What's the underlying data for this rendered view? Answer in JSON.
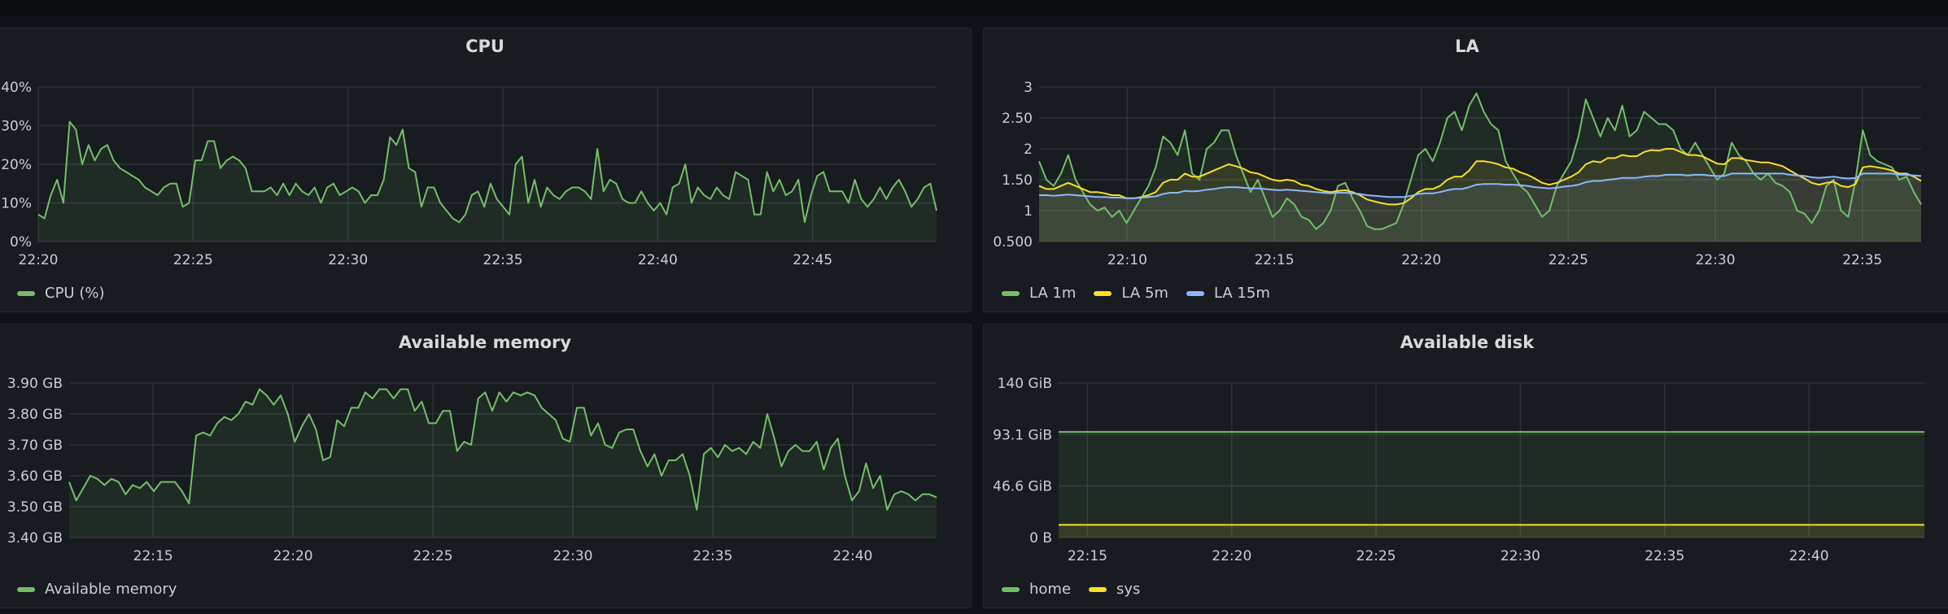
{
  "panels": [
    {
      "title": "CPU",
      "chart_data": {
        "type": "area",
        "x_start": "22:20",
        "x_end": "22:49",
        "x_ticks": [
          "22:20",
          "22:25",
          "22:30",
          "22:35",
          "22:40",
          "22:45"
        ],
        "y_ticks": [
          "0%",
          "10%",
          "20%",
          "30%",
          "40%"
        ],
        "ylim": [
          0,
          40
        ],
        "grid": true,
        "legend_placement": "bottom-left",
        "series": [
          {
            "name": "CPU (%)",
            "color": "#73bf69",
            "values": [
              7,
              6,
              12,
              16,
              10,
              31,
              29,
              20,
              25,
              21,
              24,
              25,
              21,
              19,
              18,
              17,
              16,
              14,
              13,
              12,
              14,
              15,
              15,
              9,
              10,
              21,
              21,
              26,
              26,
              19,
              21,
              22,
              21,
              19,
              13,
              13,
              13,
              14,
              12,
              15,
              12,
              15,
              13,
              12,
              14,
              10,
              14,
              15,
              12,
              13,
              14,
              13,
              10,
              12,
              12,
              16,
              27,
              25,
              29,
              19,
              18,
              9,
              14,
              14,
              10,
              8,
              6,
              5,
              7,
              12,
              13,
              9,
              15,
              11,
              9,
              7,
              20,
              22,
              10,
              16,
              9,
              14,
              12,
              11,
              13,
              14,
              14,
              13,
              11,
              24,
              13,
              16,
              15,
              11,
              10,
              10,
              13,
              10,
              8,
              10,
              7,
              14,
              15,
              20,
              10,
              14,
              12,
              11,
              14,
              12,
              11,
              18,
              17,
              16,
              7,
              7,
              18,
              13,
              16,
              12,
              13,
              16,
              5,
              12,
              17,
              18,
              13,
              13,
              13,
              10,
              16,
              11,
              9,
              11,
              14,
              11,
              14,
              16,
              13,
              9,
              11,
              14,
              15,
              8
            ]
          }
        ]
      }
    },
    {
      "title": "LA",
      "chart_data": {
        "type": "line",
        "x_start": "22:07",
        "x_end": "22:37",
        "x_ticks": [
          "22:10",
          "22:15",
          "22:20",
          "22:25",
          "22:30",
          "22:35"
        ],
        "y_ticks": [
          "0.500",
          "1",
          "1.50",
          "2",
          "2.50",
          "3"
        ],
        "ylim": [
          0.5,
          3
        ],
        "grid": true,
        "legend_placement": "bottom-left",
        "series": [
          {
            "name": "LA 1m",
            "color": "#73bf69",
            "values": [
              1.8,
              1.5,
              1.4,
              1.6,
              1.9,
              1.5,
              1.3,
              1.1,
              1.0,
              1.05,
              0.9,
              1.0,
              0.8,
              1.0,
              1.2,
              1.4,
              1.7,
              2.2,
              2.1,
              1.9,
              2.3,
              1.6,
              1.5,
              2.0,
              2.1,
              2.3,
              2.3,
              1.9,
              1.6,
              1.3,
              1.5,
              1.2,
              0.9,
              1.0,
              1.2,
              1.1,
              0.9,
              0.85,
              0.7,
              0.8,
              1.0,
              1.4,
              1.45,
              1.2,
              1.0,
              0.75,
              0.7,
              0.7,
              0.75,
              0.8,
              1.1,
              1.5,
              1.9,
              2.0,
              1.8,
              2.1,
              2.5,
              2.6,
              2.3,
              2.7,
              2.9,
              2.6,
              2.4,
              2.3,
              1.8,
              1.6,
              1.4,
              1.3,
              1.1,
              0.9,
              1.0,
              1.4,
              1.6,
              1.8,
              2.2,
              2.8,
              2.5,
              2.2,
              2.5,
              2.3,
              2.7,
              2.2,
              2.3,
              2.6,
              2.5,
              2.4,
              2.4,
              2.3,
              2.0,
              1.9,
              2.1,
              1.9,
              1.7,
              1.5,
              1.6,
              2.1,
              1.9,
              1.8,
              1.6,
              1.5,
              1.6,
              1.45,
              1.4,
              1.3,
              1.0,
              0.95,
              0.8,
              1.0,
              1.4,
              1.5,
              1.0,
              0.9,
              1.5,
              2.3,
              1.9,
              1.8,
              1.75,
              1.7,
              1.5,
              1.55,
              1.3,
              1.1
            ]
          },
          {
            "name": "LA 5m",
            "color": "#fade2a",
            "values": [
              1.4,
              1.35,
              1.35,
              1.4,
              1.45,
              1.4,
              1.35,
              1.3,
              1.3,
              1.28,
              1.25,
              1.25,
              1.2,
              1.2,
              1.22,
              1.25,
              1.3,
              1.45,
              1.5,
              1.5,
              1.6,
              1.55,
              1.55,
              1.6,
              1.65,
              1.7,
              1.75,
              1.72,
              1.68,
              1.62,
              1.6,
              1.55,
              1.5,
              1.48,
              1.5,
              1.48,
              1.42,
              1.4,
              1.35,
              1.32,
              1.3,
              1.32,
              1.33,
              1.3,
              1.25,
              1.18,
              1.15,
              1.12,
              1.1,
              1.1,
              1.12,
              1.2,
              1.3,
              1.35,
              1.35,
              1.4,
              1.5,
              1.55,
              1.55,
              1.65,
              1.8,
              1.8,
              1.78,
              1.75,
              1.7,
              1.68,
              1.62,
              1.58,
              1.52,
              1.45,
              1.42,
              1.45,
              1.5,
              1.55,
              1.62,
              1.75,
              1.8,
              1.78,
              1.85,
              1.85,
              1.9,
              1.88,
              1.88,
              1.95,
              1.98,
              1.97,
              2.0,
              2.0,
              1.95,
              1.9,
              1.9,
              1.88,
              1.82,
              1.76,
              1.75,
              1.85,
              1.85,
              1.82,
              1.8,
              1.78,
              1.78,
              1.75,
              1.72,
              1.65,
              1.58,
              1.52,
              1.45,
              1.42,
              1.45,
              1.47,
              1.4,
              1.38,
              1.43,
              1.7,
              1.72,
              1.7,
              1.68,
              1.65,
              1.6,
              1.6,
              1.55,
              1.48
            ]
          },
          {
            "name": "LA 15m",
            "color": "#8ab8ff",
            "values": [
              1.25,
              1.25,
              1.24,
              1.25,
              1.26,
              1.25,
              1.24,
              1.23,
              1.22,
              1.22,
              1.21,
              1.21,
              1.2,
              1.2,
              1.21,
              1.22,
              1.23,
              1.27,
              1.29,
              1.29,
              1.32,
              1.31,
              1.32,
              1.34,
              1.35,
              1.37,
              1.38,
              1.38,
              1.37,
              1.36,
              1.36,
              1.35,
              1.34,
              1.33,
              1.34,
              1.33,
              1.32,
              1.31,
              1.3,
              1.29,
              1.28,
              1.29,
              1.29,
              1.28,
              1.27,
              1.25,
              1.24,
              1.23,
              1.22,
              1.22,
              1.22,
              1.24,
              1.27,
              1.28,
              1.28,
              1.3,
              1.33,
              1.35,
              1.35,
              1.38,
              1.42,
              1.43,
              1.43,
              1.43,
              1.42,
              1.42,
              1.41,
              1.4,
              1.38,
              1.37,
              1.36,
              1.37,
              1.39,
              1.4,
              1.42,
              1.46,
              1.48,
              1.48,
              1.5,
              1.51,
              1.53,
              1.53,
              1.53,
              1.55,
              1.56,
              1.56,
              1.58,
              1.58,
              1.58,
              1.57,
              1.58,
              1.58,
              1.57,
              1.56,
              1.56,
              1.6,
              1.6,
              1.6,
              1.6,
              1.6,
              1.6,
              1.6,
              1.6,
              1.58,
              1.57,
              1.56,
              1.54,
              1.53,
              1.54,
              1.55,
              1.53,
              1.52,
              1.53,
              1.6,
              1.6,
              1.6,
              1.6,
              1.6,
              1.58,
              1.58,
              1.57,
              1.56
            ]
          }
        ]
      }
    },
    {
      "title": "Available memory",
      "chart_data": {
        "type": "area",
        "x_start": "22:12",
        "x_end": "22:43",
        "x_ticks": [
          "22:15",
          "22:20",
          "22:25",
          "22:30",
          "22:35",
          "22:40"
        ],
        "y_ticks": [
          "3.40 GB",
          "3.50 GB",
          "3.60 GB",
          "3.70 GB",
          "3.80 GB",
          "3.90 GB"
        ],
        "ylim": [
          3.4,
          3.9
        ],
        "grid": true,
        "legend_placement": "bottom-left",
        "series": [
          {
            "name": "Available memory",
            "color": "#73bf69",
            "values": [
              3.58,
              3.52,
              3.56,
              3.6,
              3.59,
              3.57,
              3.59,
              3.58,
              3.54,
              3.57,
              3.56,
              3.58,
              3.55,
              3.58,
              3.58,
              3.58,
              3.55,
              3.51,
              3.73,
              3.74,
              3.73,
              3.77,
              3.79,
              3.78,
              3.8,
              3.84,
              3.83,
              3.88,
              3.86,
              3.83,
              3.86,
              3.8,
              3.71,
              3.76,
              3.8,
              3.75,
              3.65,
              3.66,
              3.78,
              3.76,
              3.82,
              3.82,
              3.87,
              3.85,
              3.88,
              3.88,
              3.85,
              3.88,
              3.88,
              3.81,
              3.84,
              3.77,
              3.77,
              3.81,
              3.81,
              3.68,
              3.71,
              3.7,
              3.85,
              3.87,
              3.81,
              3.87,
              3.84,
              3.87,
              3.86,
              3.87,
              3.86,
              3.82,
              3.8,
              3.78,
              3.72,
              3.71,
              3.82,
              3.82,
              3.73,
              3.77,
              3.7,
              3.69,
              3.74,
              3.75,
              3.75,
              3.68,
              3.63,
              3.67,
              3.6,
              3.65,
              3.65,
              3.67,
              3.6,
              3.49,
              3.67,
              3.69,
              3.66,
              3.7,
              3.68,
              3.69,
              3.67,
              3.71,
              3.69,
              3.8,
              3.72,
              3.63,
              3.68,
              3.7,
              3.68,
              3.68,
              3.71,
              3.62,
              3.69,
              3.72,
              3.6,
              3.52,
              3.55,
              3.64,
              3.56,
              3.6,
              3.49,
              3.54,
              3.55,
              3.54,
              3.52,
              3.54,
              3.54,
              3.53
            ]
          }
        ]
      }
    },
    {
      "title": "Available disk",
      "chart_data": {
        "type": "area",
        "x_start": "22:14",
        "x_end": "22:44",
        "x_ticks": [
          "22:15",
          "22:20",
          "22:25",
          "22:30",
          "22:35",
          "22:40"
        ],
        "y_ticks": [
          "0 B",
          "46.6 GiB",
          "93.1 GiB",
          "140 GiB"
        ],
        "ylim": [
          0,
          139.7
        ],
        "grid": true,
        "legend_placement": "bottom-left",
        "series": [
          {
            "name": "home",
            "color": "#73bf69",
            "values": [
              95.5,
              95.5
            ]
          },
          {
            "name": "sys",
            "color": "#fade2a",
            "values": [
              11.5,
              11.5
            ]
          }
        ]
      }
    }
  ]
}
